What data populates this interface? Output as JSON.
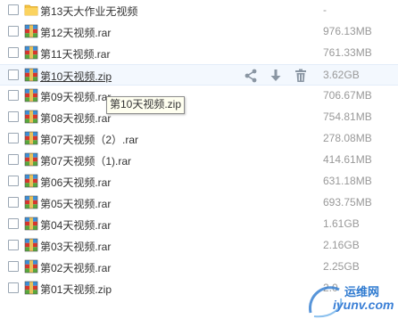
{
  "files": [
    {
      "name": "第13天大作业无视频",
      "size": "-",
      "type": "folder"
    },
    {
      "name": "第12天视频.rar",
      "size": "976.13MB",
      "type": "rar"
    },
    {
      "name": "第11天视频.rar",
      "size": "761.33MB",
      "type": "rar"
    },
    {
      "name": "第10天视频.zip",
      "size": "3.62GB",
      "type": "zip",
      "hovered": true
    },
    {
      "name": "第09天视频.rar",
      "size": "706.67MB",
      "type": "rar"
    },
    {
      "name": "第08天视频.rar",
      "size": "754.81MB",
      "type": "rar"
    },
    {
      "name": "第07天视频（2）.rar",
      "size": "278.08MB",
      "type": "rar"
    },
    {
      "name": "第07天视频（1).rar",
      "size": "414.61MB",
      "type": "rar"
    },
    {
      "name": "第06天视频.rar",
      "size": "631.18MB",
      "type": "rar"
    },
    {
      "name": "第05天视频.rar",
      "size": "693.75MB",
      "type": "rar"
    },
    {
      "name": "第04天视频.rar",
      "size": "1.61GB",
      "type": "rar"
    },
    {
      "name": "第03天视频.rar",
      "size": "2.16GB",
      "type": "rar"
    },
    {
      "name": "第02天视频.rar",
      "size": "2.25GB",
      "type": "rar"
    },
    {
      "name": "第01天视频.zip",
      "size": "2.0",
      "type": "zip"
    }
  ],
  "row_actions": [
    "share-icon",
    "download-icon",
    "delete-icon"
  ],
  "tooltip": "第10天视频.zip",
  "watermark": {
    "brand": "运维网",
    "url": "iyunv.com"
  },
  "colors": {
    "hover_row": "#f3f8fe",
    "size_text": "#999999",
    "watermark": "#2e7ad0"
  }
}
